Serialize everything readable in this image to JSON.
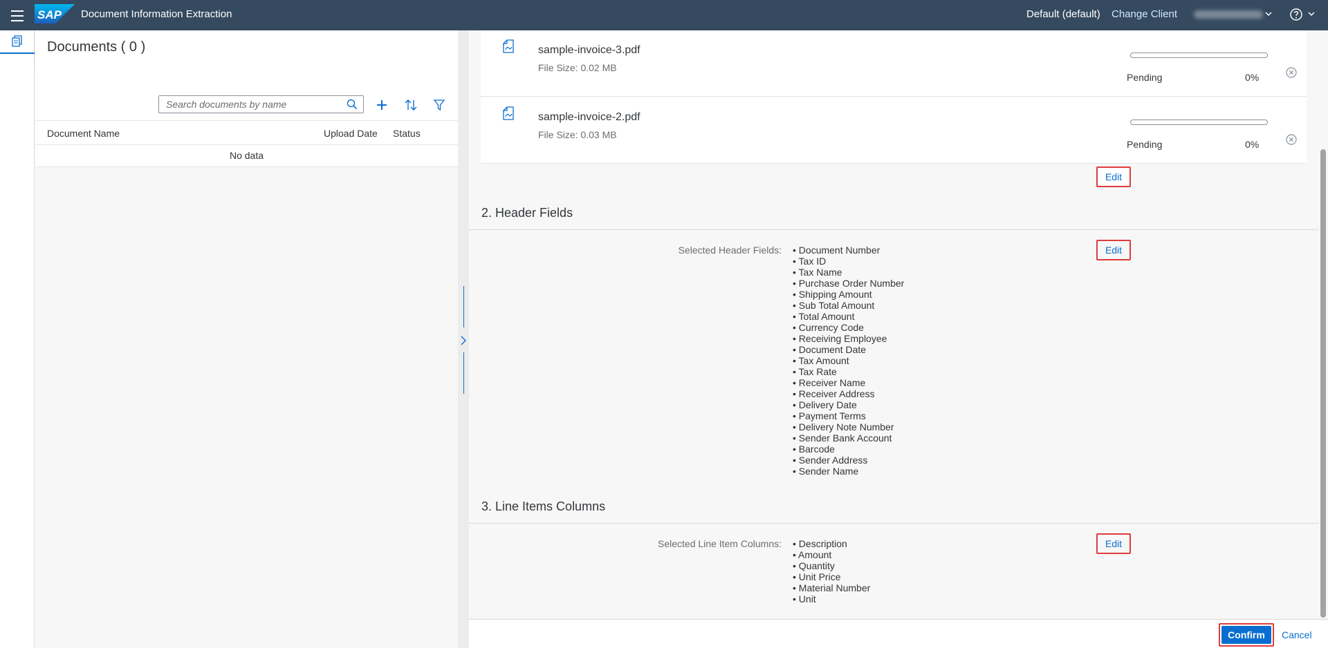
{
  "shell": {
    "title": "Document Information Extraction",
    "tenant": "Default (default)",
    "change_client": "Change Client",
    "brand_color": "#354a5f",
    "logo_text": "SAP"
  },
  "master": {
    "title": "Documents ( 0 )",
    "search_placeholder": "Search documents by name",
    "columns": [
      "Document Name",
      "Upload Date",
      "Status"
    ],
    "no_data": "No data"
  },
  "files": [
    {
      "name": "sample-invoice-3.pdf",
      "size": "File Size: 0.02 MB",
      "status": "Pending",
      "percent_label": "0%",
      "progress": 0
    },
    {
      "name": "sample-invoice-2.pdf",
      "size": "File Size: 0.03 MB",
      "status": "Pending",
      "percent_label": "0%",
      "progress": 0
    }
  ],
  "edit_label": "Edit",
  "header_fields": {
    "title": "2. Header Fields",
    "label": "Selected Header Fields:",
    "items": [
      "Document Number",
      "Tax ID",
      "Tax Name",
      "Purchase Order Number",
      "Shipping Amount",
      "Sub Total Amount",
      "Total Amount",
      "Currency Code",
      "Receiving Employee",
      "Document Date",
      "Tax Amount",
      "Tax Rate",
      "Receiver Name",
      "Receiver Address",
      "Delivery Date",
      "Payment Terms",
      "Delivery Note Number",
      "Sender Bank Account",
      "Barcode",
      "Sender Address",
      "Sender Name"
    ]
  },
  "line_items": {
    "title": "3. Line Items Columns",
    "label": "Selected Line Item Columns:",
    "items": [
      "Description",
      "Amount",
      "Quantity",
      "Unit Price",
      "Material Number",
      "Unit"
    ]
  },
  "footer": {
    "confirm": "Confirm",
    "cancel": "Cancel"
  },
  "colors": {
    "accent": "#0a6ed1",
    "highlight": "#e03b3b"
  }
}
